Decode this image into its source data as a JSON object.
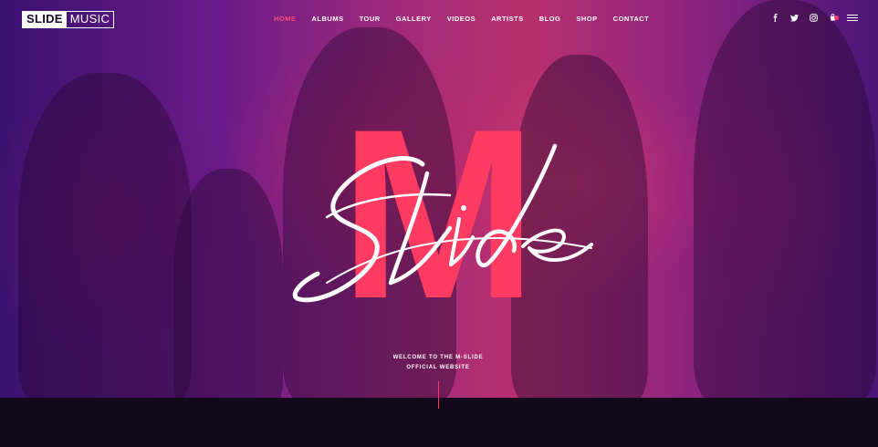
{
  "brand": {
    "logo_bold": "SLIDE",
    "logo_light": "MUSIC"
  },
  "nav": {
    "items": [
      {
        "label": "HOME",
        "active": true
      },
      {
        "label": "ALBUMS",
        "active": false
      },
      {
        "label": "TOUR",
        "active": false
      },
      {
        "label": "GALLERY",
        "active": false
      },
      {
        "label": "VIDEOS",
        "active": false
      },
      {
        "label": "ARTISTS",
        "active": false
      },
      {
        "label": "BLOG",
        "active": false
      },
      {
        "label": "SHOP",
        "active": false
      },
      {
        "label": "CONTACT",
        "active": false
      }
    ]
  },
  "social": {
    "icons": [
      "facebook-icon",
      "twitter-icon",
      "instagram-icon",
      "cart-icon",
      "menu-icon"
    ]
  },
  "hero": {
    "logo_letter": "M",
    "logo_script": "Slide",
    "welcome_line1": "WELCOME TO THE M-SLIDE",
    "welcome_line2": "OFFICIAL WEBSITE"
  },
  "colors": {
    "accent": "#ff3b62",
    "nav_active": "#ff4d7a",
    "bottom_bg": "#120a1a"
  }
}
